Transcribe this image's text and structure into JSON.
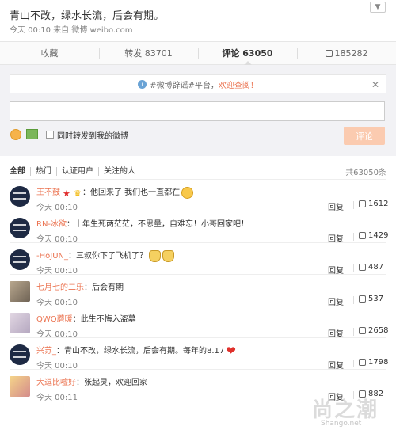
{
  "post": {
    "text": "青山不改，绿水长流，后会有期。",
    "meta": "今天 00:10 来自 微博 weibo.com"
  },
  "actions": [
    {
      "label": "收藏"
    },
    {
      "label": "转发 83701"
    },
    {
      "label": "评论 63050"
    },
    {
      "label": "185282"
    }
  ],
  "notice": {
    "text": "#微博辟谣#平台，",
    "highlight": "欢迎查阅！"
  },
  "compose": {
    "value": "",
    "repost_label": "同时转发到我的微博",
    "submit_label": "评论"
  },
  "filters": [
    "全部",
    "热门",
    "认证用户",
    "关注的人"
  ],
  "total": "共63050条",
  "comments": [
    {
      "user": "王不鼓",
      "text": "：他回来了 我们也一直都在",
      "time": "今天 00:10",
      "reply": "回复",
      "likes": "1612"
    },
    {
      "user": "RN-冰欲",
      "text": "：十年生死两茫茫，不思量，自难忘！小哥回家吧！",
      "time": "今天 00:10",
      "reply": "回复",
      "likes": "1429"
    },
    {
      "user": "-HoJUN_",
      "text": "：三叔你下了飞机了？",
      "time": "今天 00:10",
      "reply": "回复",
      "likes": "487"
    },
    {
      "user": "七月七的二乐",
      "text": "：后会有期",
      "time": "今天 00:10",
      "reply": "回复",
      "likes": "537"
    },
    {
      "user": "QWQ蘑暖",
      "text": "：此生不悔入盗墓",
      "time": "今天 00:10",
      "reply": "回复",
      "likes": "2658"
    },
    {
      "user": "兴苏_",
      "text": "：青山不改，绿水长流，后会有期。每年的8.17",
      "time": "今天 00:10",
      "reply": "回复",
      "likes": "1798"
    },
    {
      "user": "大逗比嘘好",
      "text": "：张起灵，欢迎回家",
      "time": "今天 00:11",
      "reply": "回复",
      "likes": "882"
    }
  ],
  "watermark": {
    "text": "尚之潮",
    "url": "Shango.net"
  },
  "colors": {
    "accent": "#eb7350",
    "submit_disabled": "#fbcbb0"
  }
}
